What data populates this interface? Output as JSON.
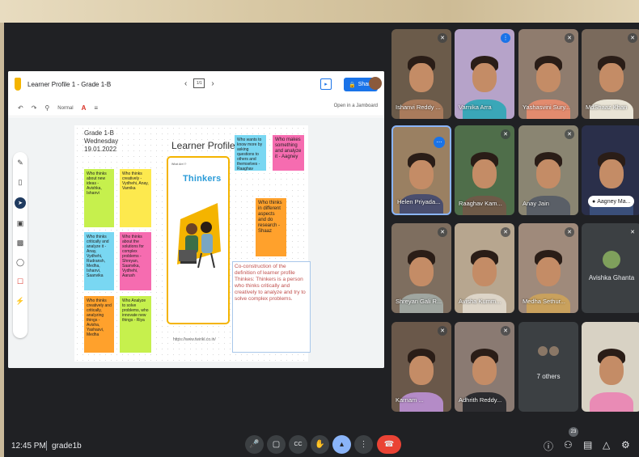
{
  "colors": {
    "accent": "#1a73e8",
    "meet_background": "#202124",
    "end_call": "#ea4335",
    "present_active": "#8ab4f8",
    "definition_text": "#c0504d"
  },
  "jamboard": {
    "title": "Learner Profile 1 - Grade 1-B",
    "frame_indicator": "1/1",
    "share_label": "Share",
    "toolbar_style": "Normal",
    "open_label": "Open in a Jamboard",
    "board": {
      "date_text": "Grade 1-B\nWednesday\n19.01.2022",
      "title": "Learner Profile",
      "thinkers_prompt": "What Are I?",
      "thinkers_word": "Thinkers",
      "url": "https://www.twinkl.co.in/",
      "definition": "Co-construction of the definition of learner profile Thinkes: Thinkers is a person who thinks critically and creatively to analyze and try to solve complex problems.",
      "notes": [
        {
          "text": "Who thinks about new ideas - Avishka, Ishanvi",
          "color": "#c6f04d"
        },
        {
          "text": "Who thinks creatively - Vydhehi, Anay, Varnika",
          "color": "#fde94e"
        },
        {
          "text": "Who thinks critically and analyze it - Anay, Vydhehi, Rudransh, Medha, Ishanvi, Saanvika",
          "color": "#79d7f2"
        },
        {
          "text": "Who thinks about the solutions for complex problems - Shreyan, Saanvika, Vydhehi, Aarush",
          "color": "#f66cb0"
        },
        {
          "text": "Who thinks creatively and critically, analyzing things - Avisha, Yashasvi, Medha",
          "color": "#ffa12c"
        },
        {
          "text": "Who Analyze to solve problems, who innovate new things - Riya",
          "color": "#c6f04d"
        },
        {
          "text": "Who wants to know more by asking questions to others and themselves - Raaghav",
          "color": "#79d7f2"
        },
        {
          "text": "Who makes something and analyze it - Aagney",
          "color": "#f66cb0"
        },
        {
          "text": "Who thinks in different aspects and do research - Shaaz",
          "color": "#ffa12c"
        }
      ]
    }
  },
  "participants": [
    {
      "name": "Ishanvi Reddy ...",
      "muted": true
    },
    {
      "name": "Varnika Arra",
      "muted": false
    },
    {
      "name": "Yashasvini Sury...",
      "muted": true
    },
    {
      "name": "MdShaaz Khan",
      "muted": true
    },
    {
      "name": "Helen Priyada...",
      "muted": false
    },
    {
      "name": "Raaghav Kam...",
      "muted": true
    },
    {
      "name": "Anay Jain",
      "muted": true
    },
    {
      "name": "Aagney Ma...",
      "muted": false
    },
    {
      "name": "Shreyan Gali R...",
      "muted": true
    },
    {
      "name": "Avisha Kumm...",
      "muted": true
    },
    {
      "name": "Medha Sethur...",
      "muted": true
    },
    {
      "name": "Avishka Ghanta",
      "muted": true
    },
    {
      "name": "Karnam ...",
      "muted": true
    },
    {
      "name": "Adhrith Reddy...",
      "muted": true
    },
    {
      "name": "7 others",
      "muted": false
    },
    {
      "name": "",
      "muted": false
    }
  ],
  "bottom_bar": {
    "time": "12:45 PM",
    "meeting_code": "grade1b",
    "participant_count": "23",
    "controls": [
      {
        "icon": "microphone-icon"
      },
      {
        "icon": "camera-icon"
      },
      {
        "icon": "captions-icon"
      },
      {
        "icon": "raise-hand-icon"
      },
      {
        "icon": "present-screen-icon"
      },
      {
        "icon": "more-options-icon"
      },
      {
        "icon": "end-call-icon"
      }
    ],
    "right_icons": [
      "info-icon",
      "people-icon",
      "chat-icon",
      "activities-icon",
      "host-controls-icon"
    ]
  }
}
